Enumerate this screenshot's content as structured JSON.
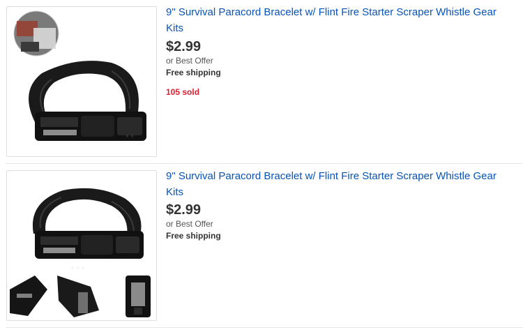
{
  "listings": [
    {
      "title": "9\" Survival Paracord Bracelet w/ Flint Fire Starter Scraper Whistle Gear Kits",
      "price": "$2.99",
      "offer": "or Best Offer",
      "shipping": "Free shipping",
      "sold": "105 sold",
      "image_icon": "paracord-bracelet-image"
    },
    {
      "title": "9\" Survival Paracord Bracelet w/ Flint Fire Starter Scraper Whistle Gear Kits",
      "price": "$2.99",
      "offer": "or Best Offer",
      "shipping": "Free shipping",
      "image_icon": "paracord-bracelet-image"
    }
  ],
  "colors": {
    "link": "#0654ba",
    "sold": "#dd1e31",
    "text": "#333333"
  }
}
